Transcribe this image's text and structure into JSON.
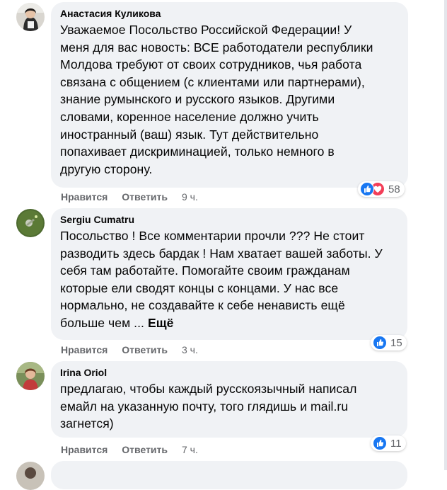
{
  "actions": {
    "like": "Нравится",
    "reply": "Ответить"
  },
  "colors": {
    "bubble": "#f0f2f5",
    "like": "#1877f2",
    "love": "#f33e58",
    "meta": "#65676b"
  },
  "comments": [
    {
      "author": "Анастасия Куликова",
      "text": "Уважаемое Посольство Российской Федерации! У\nменя для вас новость: ВСЕ работодатели республики\nМолдова требуют от своих сотрудников, чья работа\nсвязана с общением (с клиентами или партнерами),\nзнание румынского и русского языков. Другими\nсловами, коренное население должно учить\nиностранный (ваш) язык. Тут действительно\nпопахивает дискриминацией, только немного в\nдругую сторону.",
      "time": "9 ч.",
      "reactions": {
        "icons": [
          "like-icon",
          "love-icon"
        ],
        "count": "58"
      }
    },
    {
      "author": "Sergiu Cumatru",
      "text": "Посольство ! Все комментарии прочли ??? Не стоит\nразводить здесь бардак ! Нам хватает вашей заботы. У\nсебя там работайте. Помогайте своим гражданам\nкоторые ели сводят концы с концами. У нас все\nнормально, не создавайте к себе ненависть ещё\nбольше чем ... ",
      "more": "Ещё",
      "time": "3 ч.",
      "reactions": {
        "icons": [
          "like-icon"
        ],
        "count": "15"
      }
    },
    {
      "author": "Irina Oriol",
      "text": "предлагаю, чтобы каждый русскоязычный написал\nемайл на указанную почту, того глядишь и mail.ru\nзагнется)",
      "time": "7 ч.",
      "reactions": {
        "icons": [
          "like-icon"
        ],
        "count": "11"
      }
    }
  ]
}
